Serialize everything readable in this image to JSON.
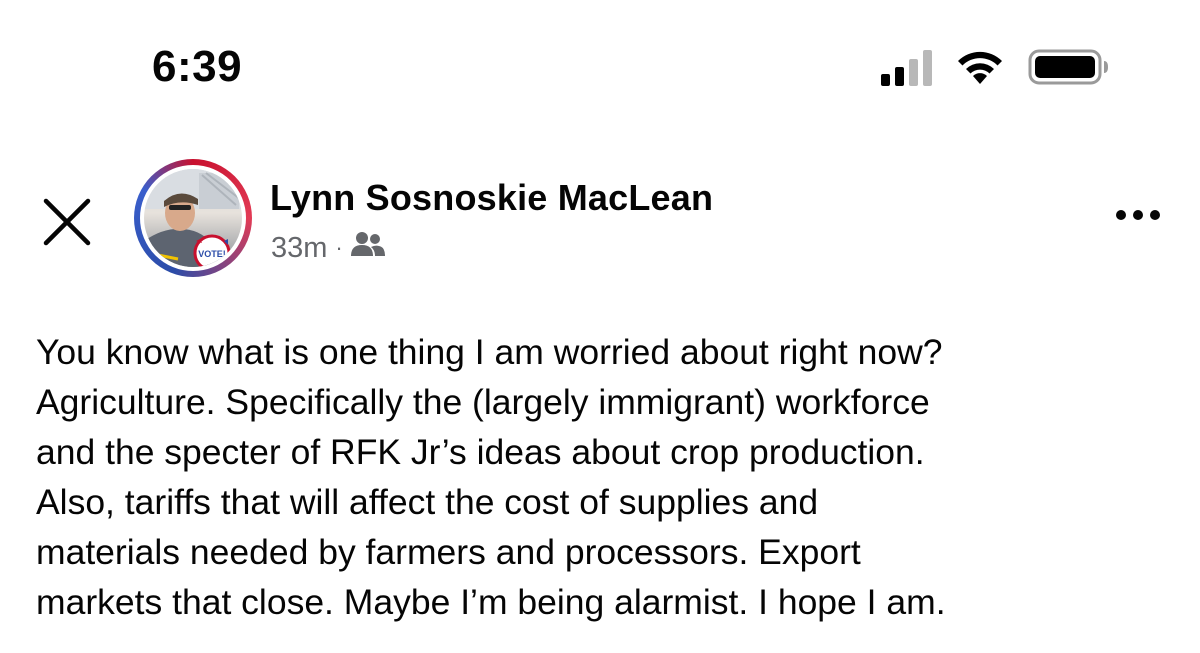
{
  "status_bar": {
    "time": "6:39",
    "signal_bars_active": 2,
    "signal_bars_total": 4,
    "icons": [
      "cellular-signal-icon",
      "wifi-icon",
      "battery-icon"
    ]
  },
  "header": {
    "close_icon": "close-icon",
    "author_name": "Lynn Sosnoskie MacLean",
    "timestamp": "33m",
    "separator": "·",
    "audience_icon": "friends-icon",
    "more_icon": "more-options-icon"
  },
  "post": {
    "lines": [
      "You know what is one thing I am worried about right now?",
      "Agriculture. Specifically the (largely immigrant) workforce",
      "and the specter of RFK Jr’s ideas about crop production.",
      "Also, tariffs that will affect the cost of supplies and",
      "materials needed by farmers and processors. Export",
      "markets that close. Maybe I’m being alarmist. I hope I am."
    ]
  },
  "colors": {
    "text_primary": "#050505",
    "text_secondary": "#65676b",
    "avatar_ring_red": "#c8102e",
    "avatar_ring_blue": "#2b4ca8"
  }
}
